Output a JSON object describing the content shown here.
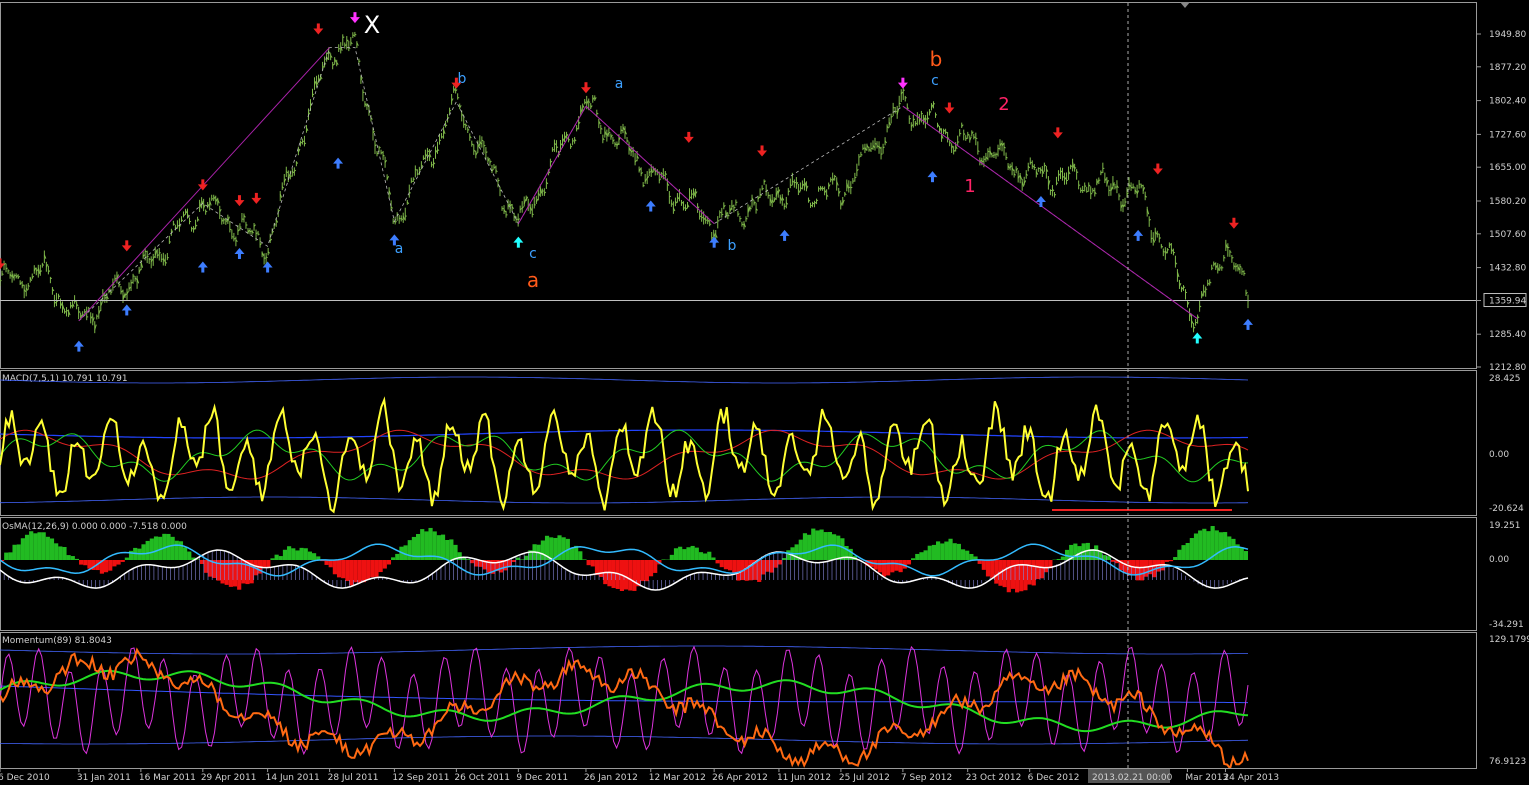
{
  "colors": {
    "background": "#000000",
    "price_bars": "#7fb84a",
    "macd_main": "#ffff33",
    "macd_signal": "#22cc22",
    "macd_third": "#dd2222",
    "macd_slow": "#2244ff",
    "band": "#4466ff",
    "osma_up": "#22bb22",
    "osma_down": "#ee1111",
    "osma_blue_line": "#33bbff",
    "osma_white_line": "#ffffff",
    "mom_orange": "#ff6a13",
    "mom_green": "#22dd22",
    "mom_magenta": "#dd33dd",
    "mom_blue": "#3355ff",
    "zigzag_purple": "#aa22aa",
    "zigzag_dash": "#bbbbbb",
    "arrow_down": "#ee2222",
    "arrow_up": "#3d7dff",
    "arrow_cyan": "#22ffff",
    "arrow_magenta": "#ff33ff",
    "label_blue": "#3da0ff",
    "label_orange": "#ff5a1a",
    "label_pink": "#ff2266",
    "label_white": "#ffffff",
    "grid": "#9a9a9a"
  },
  "price_axis": [
    "1949.80",
    "1877.20",
    "1802.40",
    "1727.60",
    "1655.00",
    "1580.20",
    "1507.60",
    "1432.80",
    "1359.94",
    "1285.40",
    "1212.80"
  ],
  "current_price": "1359.94",
  "date_axis": [
    "6 Dec 2010",
    "31 Jan 2011",
    "16 Mar 2011",
    "29 Apr 2011",
    "14 Jun 2011",
    "28 Jul 2011",
    "12 Sep 2011",
    "26 Oct 2011",
    "9 Dec 2011",
    "26 Jan 2012",
    "12 Mar 2012",
    "26 Apr 2012",
    "11 Jun 2012",
    "25 Jul 2012",
    "7 Sep 2012",
    "23 Oct 2012",
    "6 Dec 2012",
    "Mar 2013",
    "24 Apr 2013"
  ],
  "crosshair_label": "2013.02.21 00:00",
  "wave_labels": {
    "x": "X",
    "a1": "a",
    "b1": "b",
    "c1": "c",
    "A": "a",
    "a2": "a",
    "b2": "b",
    "c2": "c",
    "B": "b",
    "one": "1",
    "two": "2"
  },
  "macd": {
    "header": "MACD(7,5,1) 10.791 10.791",
    "top": "28.425",
    "zero": "0.00",
    "bottom": "-20.624"
  },
  "osma": {
    "header": "OsMA(12,26,9) 0.000 0.000 -7.518 0.000",
    "top": "19.251",
    "zero": "0.00",
    "bottom": "-34.291"
  },
  "momentum": {
    "header": "Momentum(89) 81.8043",
    "top": "129.1799",
    "bottom": "76.9123"
  },
  "chart_data": {
    "type": "line",
    "title": "",
    "y_range": [
      1212.8,
      1949.8
    ],
    "waypoints": [
      {
        "date": "6 Dec 2010",
        "value": 1400
      },
      {
        "date": "6 Jan 2011",
        "value": 1420
      },
      {
        "date": "31 Jan 2011",
        "value": 1315
      },
      {
        "date": "16 Mar 2011",
        "value": 1425
      },
      {
        "date": "29 Apr 2011",
        "value": 1575
      },
      {
        "date": "14 Jun 2011",
        "value": 1480
      },
      {
        "date": "28 Jul 2011",
        "value": 1920
      },
      {
        "date": "15 Aug 2011",
        "value": 1920
      },
      {
        "date": "12 Sep 2011",
        "value": 1535
      },
      {
        "date": "26 Oct 2011",
        "value": 1800
      },
      {
        "date": "9 Dec 2011",
        "value": 1530
      },
      {
        "date": "26 Jan 2012",
        "value": 1790
      },
      {
        "date": "12 Mar 2012",
        "value": 1640
      },
      {
        "date": "26 Apr 2012",
        "value": 1530
      },
      {
        "date": "11 Jun 2012",
        "value": 1600
      },
      {
        "date": "25 Jul 2012",
        "value": 1600
      },
      {
        "date": "7 Sep 2012",
        "value": 1790
      },
      {
        "date": "23 Oct 2012",
        "value": 1710
      },
      {
        "date": "6 Dec 2012",
        "value": 1640
      },
      {
        "date": "21 Feb 2013",
        "value": 1600
      },
      {
        "date": "4 Apr 2013",
        "value": 1320
      },
      {
        "date": "24 Apr 2013",
        "value": 1490
      },
      {
        "date": "10 May 2013",
        "value": 1359.94
      }
    ]
  }
}
